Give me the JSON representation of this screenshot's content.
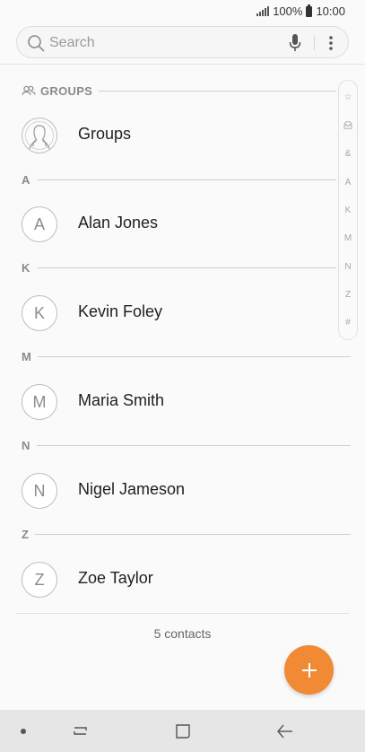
{
  "status_bar": {
    "battery_percent": "100%",
    "time": "10:00"
  },
  "search": {
    "placeholder": "Search"
  },
  "sections": {
    "groups": "GROUPS",
    "a": "A",
    "k": "K",
    "m": "M",
    "n": "N",
    "z": "Z"
  },
  "items": {
    "groups": "Groups",
    "alan": {
      "initial": "A",
      "name": "Alan Jones"
    },
    "kevin": {
      "initial": "K",
      "name": "Kevin Foley"
    },
    "maria": {
      "initial": "M",
      "name": "Maria Smith"
    },
    "nigel": {
      "initial": "N",
      "name": "Nigel Jameson"
    },
    "zoe": {
      "initial": "Z",
      "name": "Zoe Taylor"
    }
  },
  "index_scroller": [
    "☆",
    "&",
    "A",
    "K",
    "M",
    "N",
    "Z",
    "#"
  ],
  "footer": {
    "count": "5 contacts"
  },
  "colors": {
    "accent": "#f08a35",
    "nav_bg": "#e6e6e6"
  },
  "icons": {
    "search": "search-icon",
    "mic": "mic-icon",
    "more": "more-vertical-icon",
    "groups": "groups-icon",
    "add": "plus-icon",
    "nav_recent": "recent-apps-icon",
    "nav_home": "home-icon",
    "nav_back": "back-arrow-icon"
  }
}
